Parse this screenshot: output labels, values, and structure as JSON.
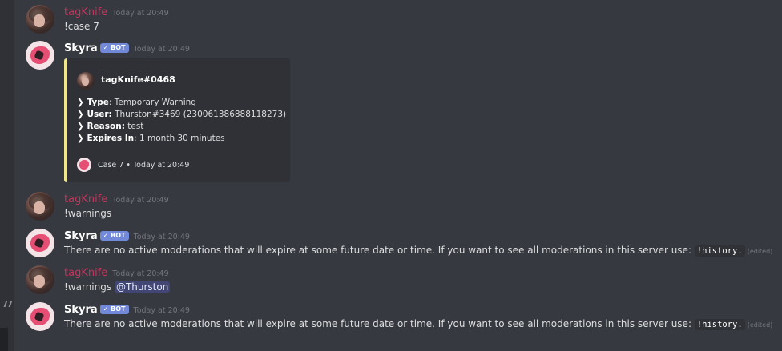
{
  "sidebar": {
    "toggle_icon": "double-chevron-icon"
  },
  "messages": [
    {
      "author": "tagKnife",
      "timestamp": "Today at 20:49",
      "content": "!case 7"
    },
    {
      "author": "Skyra",
      "badge": "✓ BOT",
      "timestamp": "Today at 20:49",
      "embed": {
        "author": "tagKnife#0468",
        "fields": [
          {
            "label": "Type",
            "value": ": Temporary Warning"
          },
          {
            "label": "User:",
            "value": " Thurston#3469 (230061386888118273)"
          },
          {
            "label": "Reason:",
            "value": " test"
          },
          {
            "label": "Expires In",
            "value": ": 1 month 30 minutes"
          }
        ],
        "footer": "Case 7 • Today at 20:49",
        "accent_color": "#f0e68c"
      }
    },
    {
      "author": "tagKnife",
      "timestamp": "Today at 20:49",
      "content": "!warnings"
    },
    {
      "author": "Skyra",
      "badge": "✓ BOT",
      "timestamp": "Today at 20:49",
      "content": "There are no active moderations that will expire at some future date or time. If you want to see all moderations in this server use: ",
      "code": "!history.",
      "edited": "(edited)"
    },
    {
      "author": "tagKnife",
      "timestamp": "Today at 20:49",
      "content": "!warnings ",
      "mention": "@Thurston"
    },
    {
      "author": "Skyra",
      "badge": "✓ BOT",
      "timestamp": "Today at 20:49",
      "content": "There are no active moderations that will expire at some future date or time. If you want to see all moderations in this server use: ",
      "code": "!history.",
      "edited": "(edited)"
    }
  ],
  "colors": {
    "background": "#36393f",
    "tagknife_name": "#c5345d",
    "bot_badge": "#7289da",
    "mention_bg": "#414675"
  }
}
